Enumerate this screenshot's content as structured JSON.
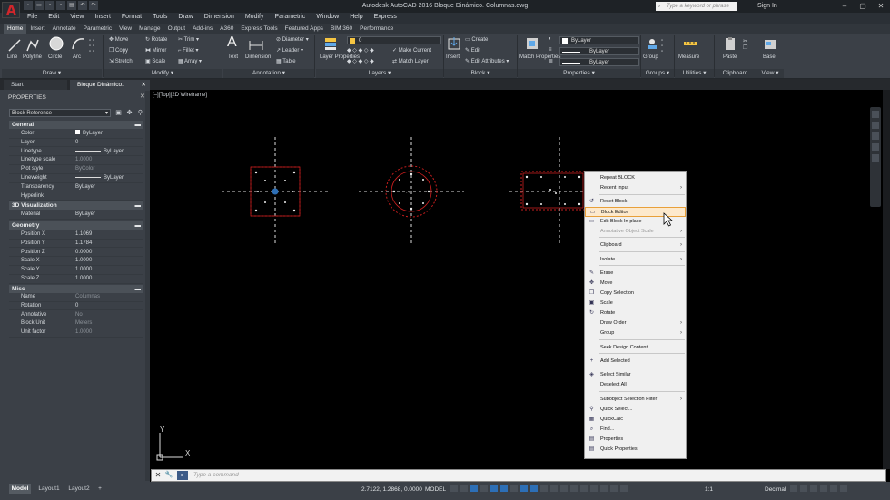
{
  "title_bar": {
    "app_logo": "A",
    "title": "Autodesk AutoCAD 2016  Bloque Dinámico. Columnas.dwg",
    "search_placeholder": "Type a keyword or phrase",
    "sign_in": "Sign In"
  },
  "menu": [
    "File",
    "Edit",
    "View",
    "Insert",
    "Format",
    "Tools",
    "Draw",
    "Dimension",
    "Modify",
    "Parametric",
    "Window",
    "Help",
    "Express"
  ],
  "ribbon_tabs": [
    "Home",
    "Insert",
    "Annotate",
    "Parametric",
    "View",
    "Manage",
    "Output",
    "Add-ins",
    "A360",
    "Express Tools",
    "Featured Apps",
    "BIM 360",
    "Performance"
  ],
  "ribbon": {
    "draw": {
      "line": "Line",
      "polyline": "Polyline",
      "circle": "Circle",
      "arc": "Arc",
      "title": "Draw"
    },
    "modify": {
      "move": "Move",
      "rotate": "Rotate",
      "trim": "Trim",
      "copy": "Copy",
      "mirror": "Mirror",
      "fillet": "Fillet",
      "stretch": "Stretch",
      "scale": "Scale",
      "array": "Array",
      "title": "Modify"
    },
    "annotation": {
      "text": "Text",
      "dimension": "Dimension",
      "diameter": "Diameter",
      "leader": "Leader",
      "table": "Table",
      "title": "Annotation"
    },
    "layers": {
      "layer_properties": "Layer Properties",
      "layer_combo": "0",
      "make_current": "Make Current",
      "match_layer": "Match Layer",
      "title": "Layers"
    },
    "block": {
      "insert": "Insert",
      "create": "Create",
      "edit": "Edit",
      "edit_attributes": "Edit Attributes",
      "title": "Block"
    },
    "properties": {
      "match_properties": "Match Properties",
      "bylayer_1": "ByLayer",
      "bylayer_2": "ByLayer",
      "bylayer_3": "ByLayer",
      "title": "Properties"
    },
    "groups": {
      "group": "Group",
      "title": "Groups"
    },
    "utilities": {
      "measure": "Measure",
      "title": "Utilities"
    },
    "clipboard": {
      "paste": "Paste",
      "title": "Clipboard"
    },
    "view": {
      "base": "Base",
      "title": "View"
    }
  },
  "file_tabs": {
    "start": "Start",
    "doc": "Bloque Dinámico. Columnas*"
  },
  "properties_palette": {
    "title": "PROPERTIES",
    "selection": "Block Reference",
    "sections": {
      "general": "General",
      "viz3d": "3D Visualization",
      "geometry": "Geometry",
      "misc": "Misc"
    },
    "general_rows": [
      {
        "k": "Color",
        "v": "ByLayer"
      },
      {
        "k": "Layer",
        "v": "0"
      },
      {
        "k": "Linetype",
        "v": "ByLayer"
      },
      {
        "k": "Linetype scale",
        "v": "1.0000"
      },
      {
        "k": "Plot style",
        "v": "ByColor"
      },
      {
        "k": "Lineweight",
        "v": "ByLayer"
      },
      {
        "k": "Transparency",
        "v": "ByLayer"
      },
      {
        "k": "Hyperlink",
        "v": ""
      }
    ],
    "viz_rows": [
      {
        "k": "Material",
        "v": "ByLayer"
      }
    ],
    "geometry_rows": [
      {
        "k": "Position X",
        "v": "1.1069"
      },
      {
        "k": "Position Y",
        "v": "1.1784"
      },
      {
        "k": "Position Z",
        "v": "0.0000"
      },
      {
        "k": "Scale X",
        "v": "1.0000"
      },
      {
        "k": "Scale Y",
        "v": "1.0000"
      },
      {
        "k": "Scale Z",
        "v": "1.0000"
      }
    ],
    "misc_rows": [
      {
        "k": "Name",
        "v": "Columnas"
      },
      {
        "k": "Rotation",
        "v": "0"
      },
      {
        "k": "Annotative",
        "v": "No"
      },
      {
        "k": "Block Unit",
        "v": "Meters"
      },
      {
        "k": "Unit factor",
        "v": "1.0000"
      }
    ]
  },
  "viewport": {
    "label": "[–][Top][2D Wireframe]",
    "ucs_x": "X",
    "ucs_y": "Y"
  },
  "context_menu": {
    "items": [
      {
        "label": "Repeat BLOCK"
      },
      {
        "label": "Recent Input",
        "arrow": "›"
      },
      {
        "label": "Reset Block",
        "icon": "↺"
      },
      {
        "label": "Block Editor",
        "icon": "▭",
        "hot": true
      },
      {
        "label": "Edit Block In-place",
        "icon": "▭"
      },
      {
        "label": "Annotative Object Scale",
        "arrow": "›",
        "disabled": true
      },
      {
        "label": "Clipboard",
        "arrow": "›"
      },
      {
        "label": "Isolate",
        "arrow": "›"
      },
      {
        "label": "Erase",
        "icon": "✎"
      },
      {
        "label": "Move",
        "icon": "✥"
      },
      {
        "label": "Copy Selection",
        "icon": "❐"
      },
      {
        "label": "Scale",
        "icon": "▣"
      },
      {
        "label": "Rotate",
        "icon": "↻"
      },
      {
        "label": "Draw Order",
        "arrow": "›"
      },
      {
        "label": "Group",
        "arrow": "›"
      },
      {
        "label": "Seek Design Content"
      },
      {
        "label": "Add Selected",
        "icon": "+"
      },
      {
        "label": "Select Similar",
        "icon": "◈"
      },
      {
        "label": "Deselect All"
      },
      {
        "label": "Subobject Selection Filter",
        "arrow": "›"
      },
      {
        "label": "Quick Select...",
        "icon": "⚲"
      },
      {
        "label": "QuickCalc",
        "icon": "▦"
      },
      {
        "label": "Find...",
        "icon": "⌕"
      },
      {
        "label": "Properties",
        "icon": "▤"
      },
      {
        "label": "Quick Properties",
        "icon": "▤"
      }
    ]
  },
  "command_line": {
    "placeholder": "Type a command",
    "close": "✕",
    "wrench": "🔧",
    "prompt": "▸"
  },
  "status_bar": {
    "model_tab": "Model",
    "layout1": "Layout1",
    "layout2": "Layout2",
    "add": "+",
    "coords": "2.7122, 1.2868, 0.0000",
    "model_label": "MODEL",
    "scale": "1:1",
    "units": "Decimal"
  },
  "colors": {
    "accent_red": "#c81e1e",
    "grip_blue": "#2d6fb7",
    "hover": "#e8a03a"
  }
}
